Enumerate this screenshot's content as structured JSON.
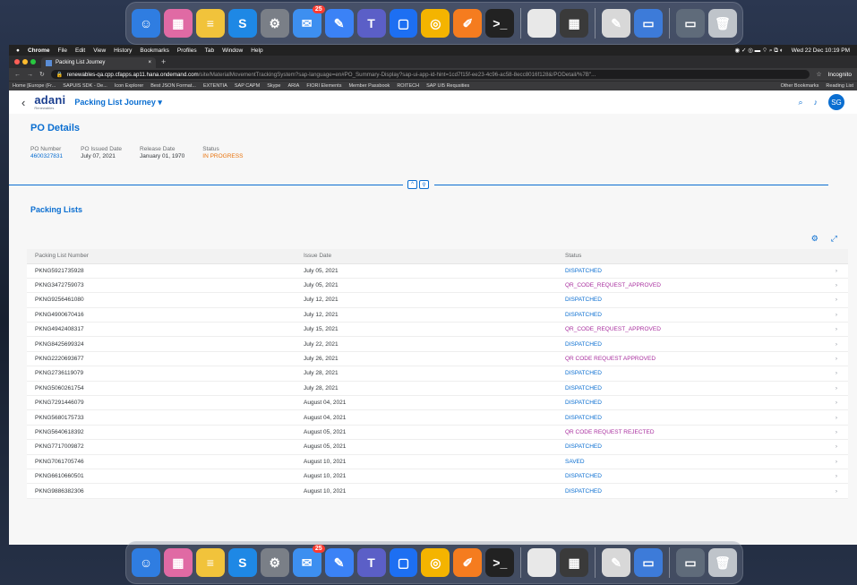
{
  "dock": {
    "badge": "25",
    "icons": [
      {
        "name": "finder-icon",
        "color": "#2f7de1",
        "glyph": "☺"
      },
      {
        "name": "launchpad-icon",
        "color": "#e06aa4",
        "glyph": "▦"
      },
      {
        "name": "notes-icon",
        "color": "#f1c33b",
        "glyph": "≡"
      },
      {
        "name": "sap-icon",
        "color": "#1e88e5",
        "glyph": "S"
      },
      {
        "name": "settings-icon",
        "color": "#7a7f87",
        "glyph": "⚙"
      },
      {
        "name": "mail-icon",
        "color": "#3d8ff0",
        "glyph": "✉"
      },
      {
        "name": "safari-icon",
        "color": "#3b82f6",
        "glyph": "✎"
      },
      {
        "name": "teams-icon",
        "color": "#5b5fc7",
        "glyph": "T"
      },
      {
        "name": "webex-icon",
        "color": "#1d6ff2",
        "glyph": "▢"
      },
      {
        "name": "chrome-icon",
        "color": "#f4b400",
        "glyph": "◎"
      },
      {
        "name": "editor-icon",
        "color": "#f57c1f",
        "glyph": "✐"
      },
      {
        "name": "terminal-icon",
        "color": "#222",
        "glyph": ">_"
      },
      {
        "name": "file-icon",
        "color": "#e8e8e8",
        "glyph": ""
      },
      {
        "name": "calculator-icon",
        "color": "#3a3a3a",
        "glyph": "▦"
      },
      {
        "name": "preview-icon",
        "color": "#d8d8d8",
        "glyph": "✎"
      },
      {
        "name": "finder-window-icon",
        "color": "#3d7bd9",
        "glyph": "▭"
      },
      {
        "name": "window-icon",
        "color": "#5f6b7a",
        "glyph": "▭"
      },
      {
        "name": "trash-icon",
        "color": "#bfc4ca",
        "glyph": "🗑"
      }
    ]
  },
  "menubar": {
    "apple": "",
    "items": [
      "Chrome",
      "File",
      "Edit",
      "View",
      "History",
      "Bookmarks",
      "Profiles",
      "Tab",
      "Window",
      "Help"
    ],
    "clock": "Wed 22 Dec  10:19 PM"
  },
  "browser": {
    "tab_title": "Packing List Journey",
    "tab_close": "×",
    "new_tab": "+",
    "url_host": "renewables-qa.cpp.cfapps.ap11.hana.ondemand.com",
    "url_path": "/site/MaterialMovementTrackingSystem?sap-language=en#PO_Summary-Display?sap-ui-app-id-hint=1cd7f15f-ee23-4c96-ac58-8ecc8016f128&/PODetail/%7B\"...",
    "incognito": "Incognito",
    "bookmarks": [
      "Home [Europe (Fr...",
      "SAPUIS SDK - De...",
      "Icon Explorer",
      "Best JSON Format...",
      "EXTENTIA",
      "SAP CAPM",
      "Skype",
      "ARIA",
      "FIORI Elements",
      "Member Passbook",
      "ROITECH",
      "SAP UI5 Requsities"
    ],
    "bookmarks_right": [
      "Other Bookmarks",
      "Reading List"
    ]
  },
  "shell": {
    "back": "‹",
    "logo_brand": "adani",
    "logo_sub": "Renewables",
    "app_title": "Packing List Journey ▾",
    "search": "⌕",
    "bell": "♪",
    "avatar": "SG"
  },
  "po": {
    "title": "PO Details",
    "fields": [
      {
        "label": "PO Number",
        "value": "4600327831",
        "style": "link"
      },
      {
        "label": "PO Issued Date",
        "value": "July 07, 2021",
        "style": ""
      },
      {
        "label": "Release Date",
        "value": "January 01, 1970",
        "style": ""
      },
      {
        "label": "Status",
        "value": "IN PROGRESS",
        "style": "warn"
      }
    ],
    "collapse_up": "^",
    "pin": "⚲"
  },
  "packing": {
    "title": "Packing Lists",
    "settings_icon": "⚙",
    "fullscreen_icon": "⤢",
    "columns": [
      "Packing List Number",
      "Issue Date",
      "Status"
    ],
    "chevron": "›",
    "rows": [
      [
        "PKNG5921735928",
        "July 05, 2021",
        "DISPATCHED"
      ],
      [
        "PKNG3472759073",
        "July 05, 2021",
        "QR_CODE_REQUEST_APPROVED"
      ],
      [
        "PKNG9256461080",
        "July 12, 2021",
        "DISPATCHED"
      ],
      [
        "PKNG4900670416",
        "July 12, 2021",
        "DISPATCHED"
      ],
      [
        "PKNG4942408317",
        "July 15, 2021",
        "QR_CODE_REQUEST_APPROVED"
      ],
      [
        "PKNG8425699324",
        "July 22, 2021",
        "DISPATCHED"
      ],
      [
        "PKNG2220693677",
        "July 26, 2021",
        "QR CODE REQUEST APPROVED"
      ],
      [
        "PKNG2736119079",
        "July 28, 2021",
        "DISPATCHED"
      ],
      [
        "PKNG5060261754",
        "July 28, 2021",
        "DISPATCHED"
      ],
      [
        "PKNG7291446079",
        "August 04, 2021",
        "DISPATCHED"
      ],
      [
        "PKNG5680175733",
        "August 04, 2021",
        "DISPATCHED"
      ],
      [
        "PKNG5640618392",
        "August 05, 2021",
        "QR CODE REQUEST REJECTED"
      ],
      [
        "PKNG7717009872",
        "August 05, 2021",
        "DISPATCHED"
      ],
      [
        "PKNG7061705746",
        "August 10, 2021",
        "SAVED"
      ],
      [
        "PKNG6610660501",
        "August 10, 2021",
        "DISPATCHED"
      ],
      [
        "PKNG9886382306",
        "August 10, 2021",
        "DISPATCHED"
      ]
    ]
  },
  "colors": {
    "accent": "#0a6ed1",
    "status_purple": "#a9309f",
    "warning": "#e9730c"
  }
}
